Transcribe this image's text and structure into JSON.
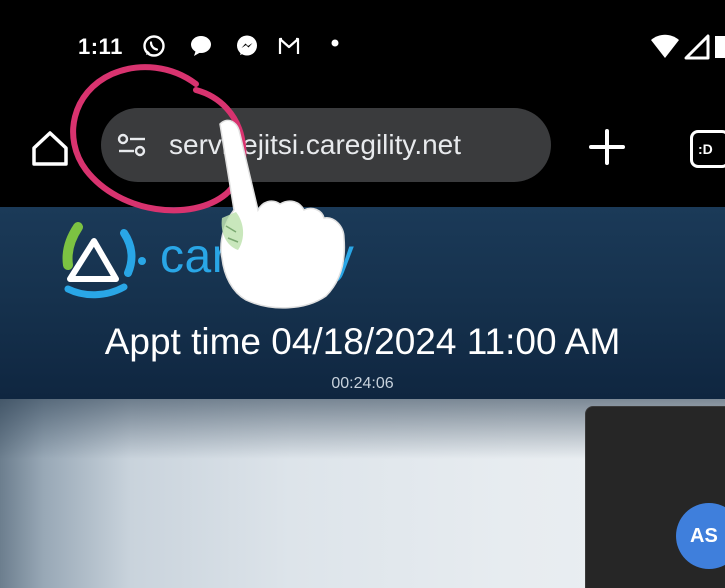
{
  "status_bar": {
    "time": "1:11",
    "icons": [
      "whatsapp-icon",
      "chat-bubble-icon",
      "messenger-icon",
      "gmail-icon",
      "notification-dot-icon",
      "wifi-icon",
      "signal-icon"
    ]
  },
  "browser": {
    "url": "servicejitsi.caregility.net",
    "home_icon": "home-icon",
    "site_info_icon": "tune-icon",
    "new_tab_icon": "plus-icon",
    "tabs_label": ":D"
  },
  "page": {
    "logo_text": "caregility",
    "appt_time": "Appt time 04/18/2024 11:00 AM",
    "timer": "00:24:06"
  },
  "call": {
    "self_avatar_initials": "AS"
  },
  "colors": {
    "header_bg": "#16324e",
    "logo_blue": "#29a6e6",
    "avatar_blue": "#3f7fdc",
    "annotation_circle": "#d8336f",
    "url_bar_bg": "#3a3b3d"
  }
}
